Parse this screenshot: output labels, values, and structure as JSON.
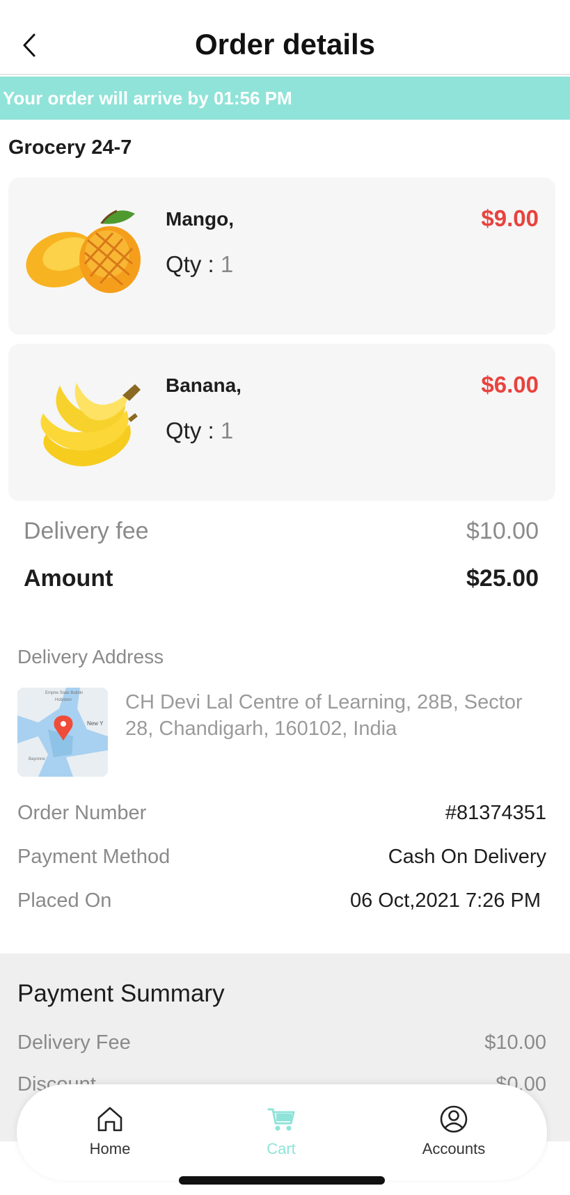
{
  "header": {
    "title": "Order details",
    "back_icon": "chevron-left-icon"
  },
  "banner": {
    "text": "Your order will arrive by 01:56 PM",
    "color": "#90e3d8"
  },
  "store": {
    "name": "Grocery 24-7"
  },
  "items": [
    {
      "name": "Mango,",
      "qty_label": "Qty :",
      "qty": "1",
      "price": "$9.00",
      "image": "mango-image"
    },
    {
      "name": "Banana,",
      "qty_label": "Qty :",
      "qty": "1",
      "price": "$6.00",
      "image": "banana-image"
    }
  ],
  "totals": {
    "delivery_fee_label": "Delivery fee",
    "delivery_fee": "$10.00",
    "amount_label": "Amount",
    "amount": "$25.00"
  },
  "address": {
    "label": "Delivery Address",
    "text": "CH Devi Lal Centre of Learning, 28B, Sector 28, Chandigarh, 160102, India",
    "map_labels": {
      "a": "Empire State Buildin",
      "b": "Hoboken",
      "c": "New Y",
      "d": "Bayonne"
    }
  },
  "order_info": {
    "order_number_label": "Order Number",
    "order_number": "#81374351",
    "payment_method_label": "Payment Method",
    "payment_method": "Cash On Delivery",
    "placed_on_label": "Placed On",
    "placed_on": "06 Oct,2021 7:26 PM"
  },
  "payment_summary": {
    "title": "Payment Summary",
    "delivery_fee_label": "Delivery Fee",
    "delivery_fee": "$10.00",
    "discount_label": "Discount",
    "discount": "$0.00"
  },
  "nav": {
    "items": [
      {
        "label": "Home",
        "icon": "home-icon"
      },
      {
        "label": "Cart",
        "icon": "cart-icon",
        "active": true
      },
      {
        "label": "Accounts",
        "icon": "account-icon"
      }
    ]
  },
  "colors": {
    "accent": "#90e3d8",
    "price": "#e8433e"
  }
}
